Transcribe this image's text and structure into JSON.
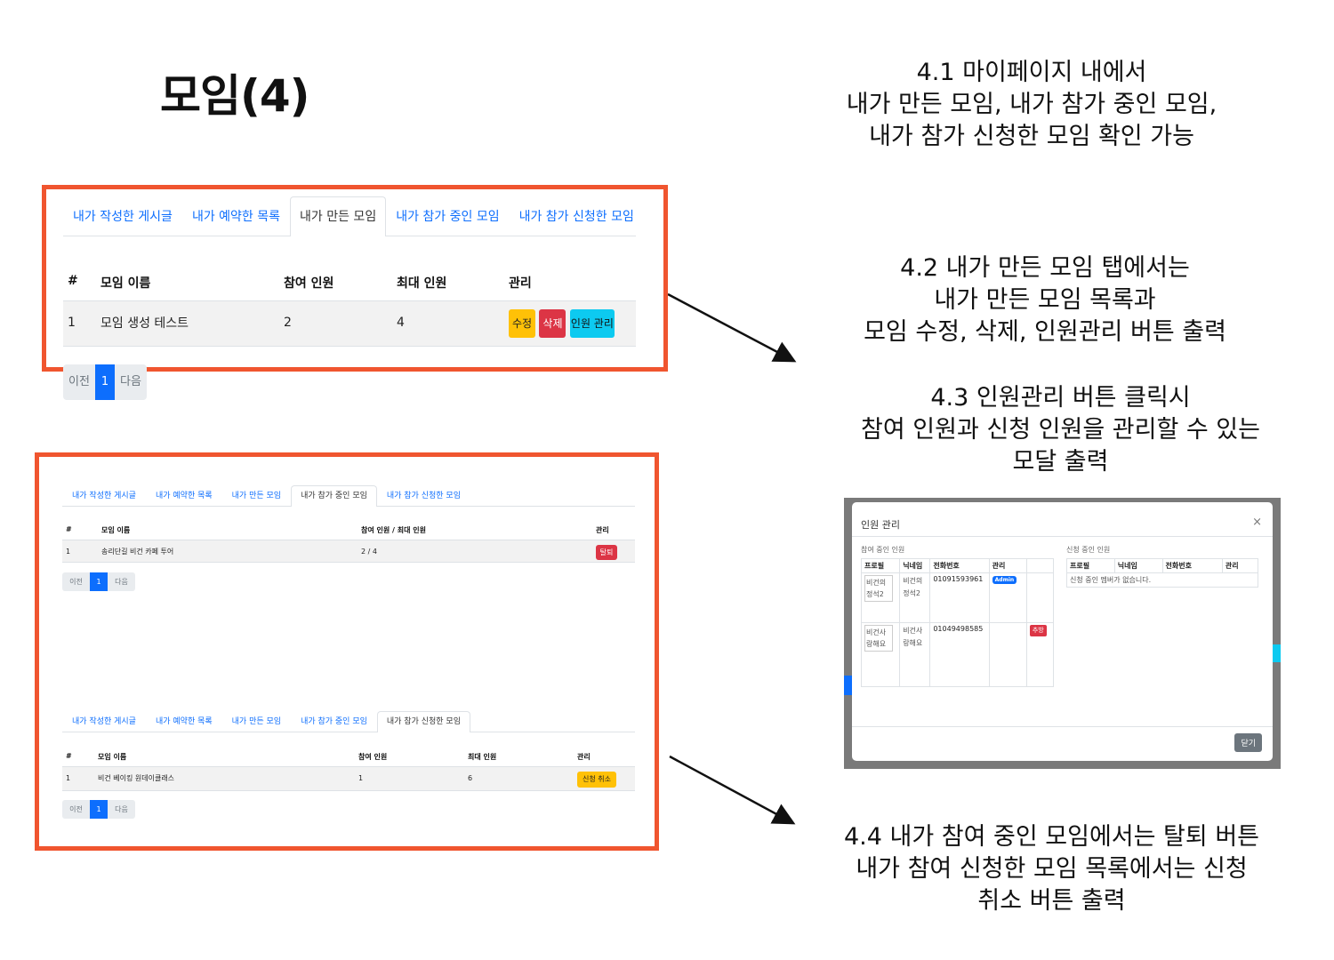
{
  "slide": {
    "title": "모임(4)"
  },
  "notes": {
    "n41": [
      "4.1 마이페이지 내에서",
      "내가 만든 모임, 내가 참가 중인 모임,",
      "내가 참가 신청한 모임 확인 가능"
    ],
    "n42": [
      "4.2 내가 만든 모임 탭에서는",
      "내가 만든 모임 목록과",
      "모임 수정, 삭제, 인원관리 버튼 출력"
    ],
    "n43": [
      "4.3 인원관리 버튼 클릭시",
      "참여 인원과 신청 인원을 관리할 수 있는",
      "모달 출력"
    ],
    "n44": [
      "4.4 내가 참여 중인 모임에서는 탈퇴 버튼",
      "내가 참여 신청한 모임 목록에서는 신청",
      "취소 버튼 출력"
    ]
  },
  "tab_labels": [
    "내가 작성한 게시글",
    "내가 예약한 목록",
    "내가 만든 모임",
    "내가 참가 중인 모임",
    "내가 참가 신청한 모임"
  ],
  "panel_created": {
    "headers": [
      "#",
      "모임 이름",
      "참여 인원",
      "최대 인원",
      "관리"
    ],
    "row": {
      "num": "1",
      "name": "모임 생성 테스트",
      "joined": "2",
      "max": "4"
    },
    "buttons": {
      "edit": "수정",
      "delete": "삭제",
      "manage": "인원 관리"
    }
  },
  "panel_joined": {
    "headers": [
      "#",
      "모임 이름",
      "참여 인원 / 최대 인원",
      "관리"
    ],
    "row": {
      "num": "1",
      "name": "송리단길 비건 카페 투어",
      "count": "2 / 4"
    },
    "buttons": {
      "leave": "탈퇴"
    }
  },
  "panel_applied": {
    "headers": [
      "#",
      "모임 이름",
      "참여 인원",
      "최대 인원",
      "관리"
    ],
    "row": {
      "num": "1",
      "name": "비건 베이킹 원데이클래스",
      "joined": "1",
      "max": "6"
    },
    "buttons": {
      "cancel": "신청 취소"
    }
  },
  "pagination": {
    "prev": "이전",
    "page": "1",
    "next": "다음"
  },
  "modal": {
    "title": "인원 관리",
    "close": "×",
    "participants_label": "참여 중인 인원",
    "applicants_label": "신청 중인 인원",
    "headers": [
      "프로필",
      "닉네임",
      "전화번호",
      "관리"
    ],
    "participants": [
      {
        "img_alt": "비건의 정석2",
        "nickname": "비건의 정석2",
        "phone": "01091593961",
        "badge": "Admin"
      },
      {
        "img_alt": "비건사랑해요",
        "nickname": "비건사랑해요",
        "phone": "01049498585",
        "kick": "추방"
      }
    ],
    "no_applicants": "신청 중인 멤버가 없습니다.",
    "close_button": "닫기"
  },
  "colors": {
    "frame": "#f0552f",
    "link": "#0d6efd",
    "warning": "#ffc107",
    "danger": "#dc3545",
    "info": "#0dcaf0"
  }
}
